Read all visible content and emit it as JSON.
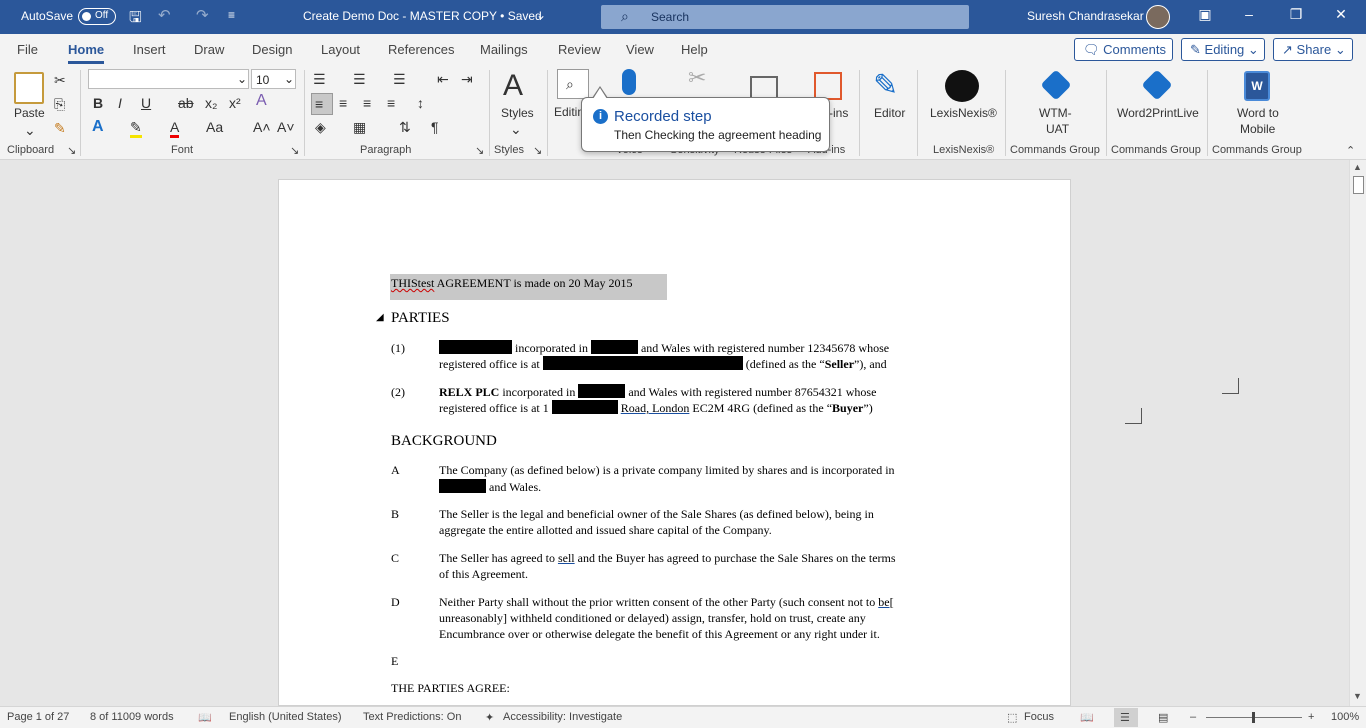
{
  "titlebar": {
    "autosave_label": "AutoSave",
    "autosave_state": "Off",
    "doc_title": "Create Demo Doc - MASTER COPY • Saved",
    "search_placeholder": "Search",
    "user_name": "Suresh Chandrasekar"
  },
  "menu": {
    "tabs": [
      "File",
      "Home",
      "Insert",
      "Draw",
      "Design",
      "Layout",
      "References",
      "Mailings",
      "Review",
      "View",
      "Help"
    ],
    "active_tab": "Home",
    "comments_label": "Comments",
    "editing_label": "Editing",
    "share_label": "Share"
  },
  "ribbon": {
    "clipboard": {
      "group": "Clipboard",
      "paste": "Paste"
    },
    "font": {
      "group": "Font",
      "font_name": "",
      "font_size": "10"
    },
    "paragraph": {
      "group": "Paragraph"
    },
    "styles": {
      "group": "Styles",
      "label": "Styles"
    },
    "editing_label": "Editin",
    "voice_group": "Voice",
    "sensitivity_group": "Sensitivity",
    "reuse_group": "Reuse Files",
    "addins_label": "-ins",
    "addins_group": "Add-ins",
    "editor_label": "Editor",
    "lexis_label": "LexisNexis®",
    "lexis_group": "LexisNexis®",
    "wtm_label_1": "WTM-",
    "wtm_label_2": "UAT",
    "w2p_label": "Word2PrintLive",
    "w2m_label_1": "Word to",
    "w2m_label_2": "Mobile",
    "commands_group": "Commands Group"
  },
  "callout": {
    "title": "Recorded step",
    "subtitle": "Then Checking the agreement heading"
  },
  "document": {
    "title_line_a": "THIStest",
    "title_line_b": " AGREEMENT is made on 20 May 2015",
    "parties_heading": "PARTIES",
    "p1_num": "(1)",
    "p1_a": "incorporated in",
    "p1_b": "and Wales with registered number 12345678 whose",
    "p1_c": "registered office is at",
    "p1_d": "(defined as the “",
    "p1_bold": "Seller",
    "p1_e": "”), and",
    "p2_num": "(2)",
    "p2_bold": "RELX PLC",
    "p2_a": " incorporated in",
    "p2_b": "and Wales with registered number 87654321 whose",
    "p2_c": "registered office is at 1",
    "p2_road": "Road,  London",
    "p2_d": " EC2M 4RG (defined as the “",
    "p2_bold2": "Buyer",
    "p2_e": "”)",
    "background_heading": "BACKGROUND",
    "a_letter": "A",
    "a_line1": "The Company (as defined below) is a private company limited by shares and is incorporated in",
    "a_line2": "and Wales.",
    "b_letter": "B",
    "b_line1": "The Seller is the legal and beneficial owner of the Sale Shares (as defined below), being in",
    "b_line2": "aggregate the entire allotted and issued share capital of the Company.",
    "c_letter": "C",
    "c_line1a": "The Seller has agreed to ",
    "c_sell": "sell",
    "c_line1b": " and the Buyer has agreed to purchase the Sale Shares on the terms",
    "c_line2": "of this Agreement.",
    "d_letter": "D",
    "d_line1a": "Neither Party shall without the prior written consent of the other Party (such consent not to ",
    "d_be": "be[",
    "d_line2": "unreasonably] withheld conditioned or delayed) assign, transfer, hold on trust, create any",
    "d_line3": "Encumbrance over or otherwise delegate the benefit of this Agreement or any right under it.",
    "e_letter": "E",
    "agree": "THE PARTIES AGREE:"
  },
  "status": {
    "page": "Page 1 of 27",
    "words": "8 of 11009 words",
    "language": "English (United States)",
    "predictions": "Text Predictions: On",
    "accessibility": "Accessibility: Investigate",
    "focus": "Focus",
    "zoom": "100%"
  }
}
